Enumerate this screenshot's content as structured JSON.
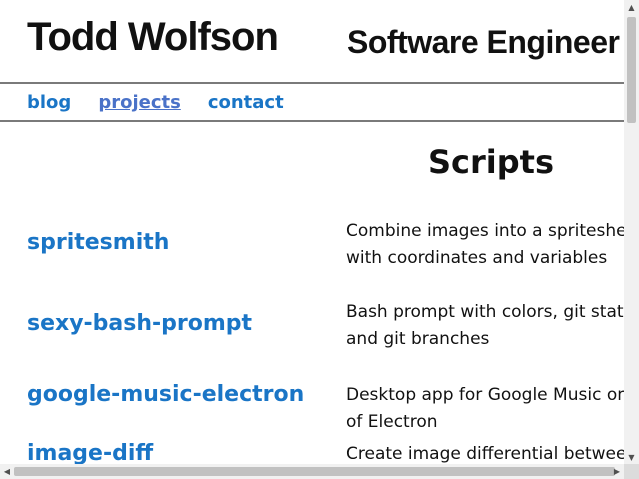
{
  "header": {
    "name": "Todd Wolfson",
    "role": "Software Engineer"
  },
  "nav": {
    "items": [
      {
        "label": "blog"
      },
      {
        "label": "projects"
      },
      {
        "label": "contact"
      }
    ],
    "active": "projects"
  },
  "main": {
    "section_title": "Scripts",
    "projects": [
      {
        "name": "spritesmith",
        "description": "Combine images into a spritesheet with coordinates and variables"
      },
      {
        "name": "sexy-bash-prompt",
        "description": "Bash prompt with colors, git status, and git branches"
      },
      {
        "name": "google-music-electron",
        "description": "Desktop app for Google Music on top of Electron"
      },
      {
        "name": "image-diff",
        "description": "Create image differential between two images"
      }
    ]
  },
  "colors": {
    "link": "#1a75c6",
    "active_link": "#4a72c8",
    "text": "#111111",
    "rule": "#7a7a7a"
  },
  "icons": {
    "scroll_up": "chevron-up-icon",
    "scroll_down": "chevron-down-icon",
    "scroll_left": "chevron-left-icon",
    "scroll_right": "chevron-right-icon"
  }
}
